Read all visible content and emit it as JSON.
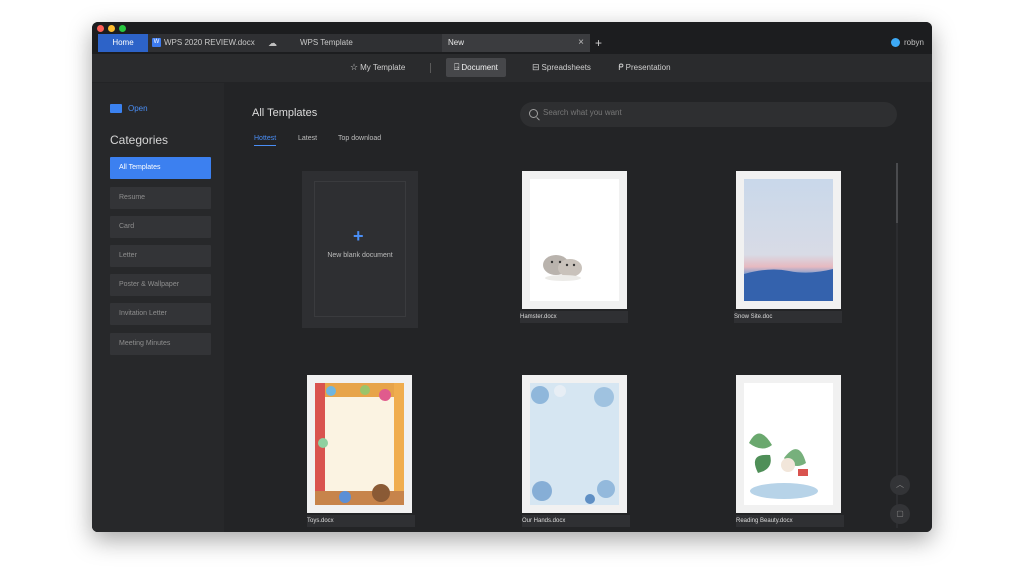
{
  "tabs": {
    "home": "Home",
    "doc": "WPS 2020 REVIEW.docx",
    "doc_icon": "W",
    "cloud_icon": "☁",
    "template": "WPS Template",
    "new": "New",
    "close": "×",
    "plus": "+"
  },
  "user": {
    "name": "robyn"
  },
  "toolbar": {
    "my_template": "My Template",
    "document": "Document",
    "spreadsheets": "Spreadsheets",
    "presentation": "Presentation",
    "icons": {
      "star": "☆",
      "doc": "⍈",
      "sheet": "⊟",
      "ppt": "ᑭ"
    }
  },
  "sidebar": {
    "open": "Open",
    "categories_title": "Categories",
    "items": [
      {
        "label": "All Templates"
      },
      {
        "label": "Resume"
      },
      {
        "label": "Card"
      },
      {
        "label": "Letter"
      },
      {
        "label": "Poster & Wallpaper"
      },
      {
        "label": "Invitation Letter"
      },
      {
        "label": "Meeting Minutes"
      }
    ]
  },
  "main": {
    "title": "All Templates",
    "search_placeholder": "Search what you want",
    "subtabs": [
      "Hottest",
      "Latest",
      "Top download"
    ],
    "blank": {
      "plus": "+",
      "label": "New blank document"
    },
    "templates": [
      {
        "name": "Hamster.docx"
      },
      {
        "name": "Snow Site.doc"
      },
      {
        "name": "Toys.docx"
      },
      {
        "name": "Our Hands.docx"
      },
      {
        "name": "Reading Beauty.docx"
      }
    ],
    "float_up": "︿",
    "float_chat": "▢"
  },
  "colors": {
    "accent": "#3c80f0",
    "bg": "#232426"
  }
}
